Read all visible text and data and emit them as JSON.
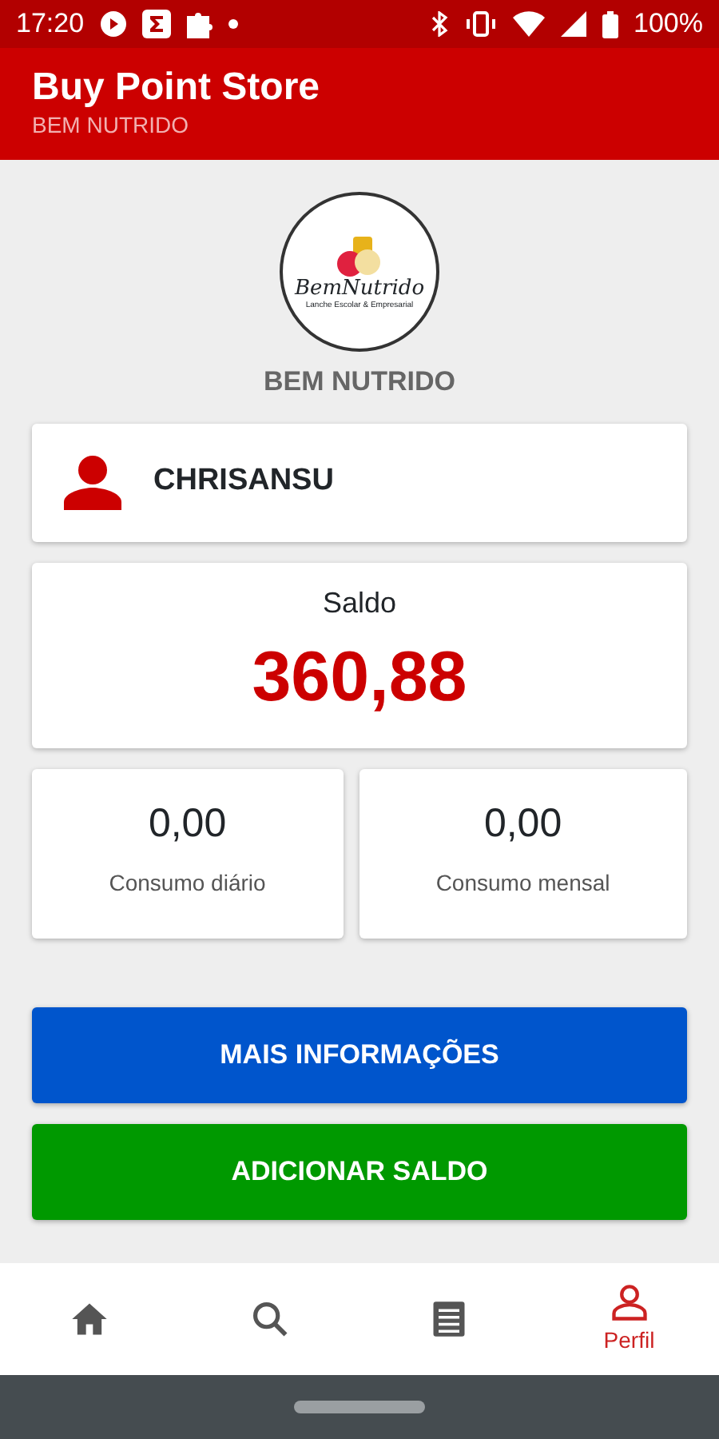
{
  "status_bar": {
    "time": "17:20",
    "battery": "100%"
  },
  "app_bar": {
    "title": "Buy Point Store",
    "subtitle": "BEM NUTRIDO"
  },
  "store": {
    "logo_title": "BemNutrido",
    "logo_subtitle": "Lanche Escolar & Empresarial",
    "name": "BEM NUTRIDO"
  },
  "user": {
    "name": "CHRISANSU"
  },
  "balance": {
    "label": "Saldo",
    "value": "360,88"
  },
  "stats": [
    {
      "value": "0,00",
      "label": "Consumo diário"
    },
    {
      "value": "0,00",
      "label": "Consumo mensal"
    }
  ],
  "buttons": [
    {
      "label": "MAIS INFORMAÇÕES",
      "kind": "info"
    },
    {
      "label": "ADICIONAR SALDO",
      "kind": "add"
    }
  ],
  "bottom_nav": [
    {
      "kind": "home",
      "selected": false
    },
    {
      "kind": "search",
      "selected": false
    },
    {
      "kind": "list",
      "selected": false
    },
    {
      "kind": "profile",
      "label": "Perfil",
      "selected": true
    }
  ]
}
